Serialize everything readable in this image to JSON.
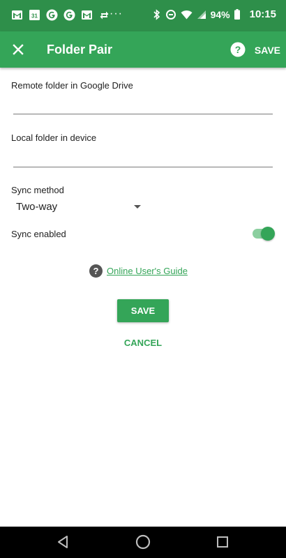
{
  "status_bar": {
    "notification_icons": [
      "gmail-icon",
      "calendar-icon",
      "google-icon",
      "google-icon",
      "gmail-icon",
      "sync-icon"
    ],
    "calendar_day": "31",
    "overflow": "···",
    "battery_percent": "94%",
    "time": "10:15"
  },
  "app_bar": {
    "title": "Folder Pair",
    "save_label": "SAVE"
  },
  "form": {
    "remote_label": "Remote folder in Google Drive",
    "remote_value": "",
    "local_label": "Local folder in device",
    "local_value": "",
    "sync_method_label": "Sync method",
    "sync_method_value": "Two-way",
    "sync_enabled_label": "Sync enabled",
    "sync_enabled": true
  },
  "guide": {
    "link_text": "Online User's Guide"
  },
  "actions": {
    "save_label": "SAVE",
    "cancel_label": "CANCEL"
  },
  "colors": {
    "status_bar": "#2e8f4a",
    "primary": "#34a558",
    "toggle_track": "#8bcf9f"
  }
}
